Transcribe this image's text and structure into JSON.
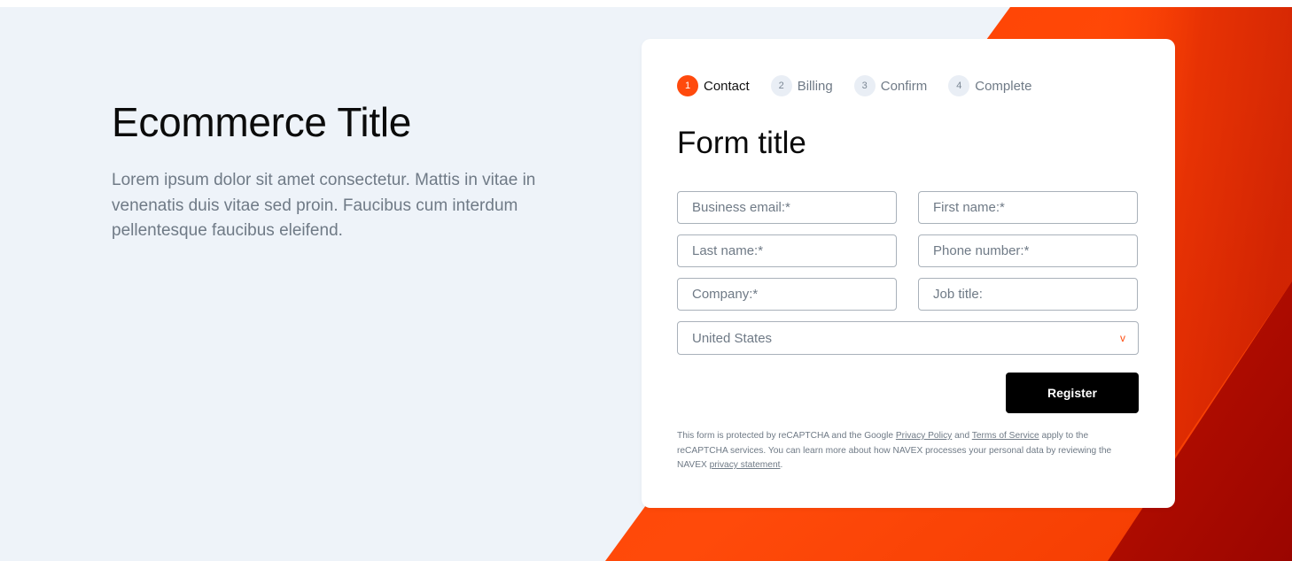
{
  "hero": {
    "title": "Ecommerce Title",
    "body": "Lorem ipsum dolor sit amet consectetur. Mattis in vitae in venenatis duis vitae sed proin. Faucibus cum interdum pellentesque faucibus eleifend."
  },
  "steps": [
    {
      "num": "1",
      "label": "Contact"
    },
    {
      "num": "2",
      "label": "Billing"
    },
    {
      "num": "3",
      "label": "Confirm"
    },
    {
      "num": "4",
      "label": "Complete"
    }
  ],
  "form": {
    "title": "Form title",
    "fields": {
      "business_email": "Business email:*",
      "first_name": "First name:*",
      "last_name": "Last name:*",
      "phone": "Phone number:*",
      "company": "Company:*",
      "job_title": "Job title:"
    },
    "country": "United States",
    "chevron": "v",
    "submit": "Register"
  },
  "legal": {
    "p1": "This form is protected by reCAPTCHA and the Google ",
    "privacy_policy": "Privacy Policy",
    "and": " and ",
    "terms": "Terms of Service",
    "p2": " apply to the reCAPTCHA services. You can learn more about how NAVEX processes your personal data by reviewing the NAVEX ",
    "privacy_statement": "privacy statement",
    "end": "."
  },
  "colors": {
    "accent": "#ff4a0d",
    "background": "#eef3f9",
    "button": "#000000"
  }
}
